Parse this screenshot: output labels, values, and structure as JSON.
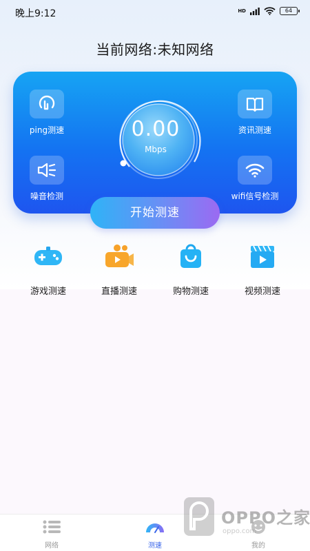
{
  "status_bar": {
    "time": "晚上9:12",
    "network_badge": "HD",
    "battery": "64"
  },
  "header": {
    "title": "当前网络:未知网络"
  },
  "speed_card": {
    "features": [
      {
        "label": "ping测速",
        "icon": "ping-icon"
      },
      {
        "label": "噪音检测",
        "icon": "noise-icon"
      },
      {
        "label": "资讯测速",
        "icon": "book-icon"
      },
      {
        "label": "wifi信号检测",
        "icon": "wifi-icon"
      }
    ],
    "gauge": {
      "value": "0.00",
      "unit": "Mbps",
      "progress": 0
    },
    "start_label": "开始测速"
  },
  "scenarios": [
    {
      "label": "游戏测速",
      "icon": "gamepad-icon"
    },
    {
      "label": "直播测速",
      "icon": "live-camera-icon"
    },
    {
      "label": "购物测速",
      "icon": "shopping-bag-icon"
    },
    {
      "label": "视频测速",
      "icon": "video-icon"
    }
  ],
  "bottom_nav": {
    "items": [
      {
        "label": "网络",
        "icon": "list-icon",
        "active": false
      },
      {
        "label": "测速",
        "icon": "speedometer-icon",
        "active": true
      },
      {
        "label": "我的",
        "icon": "profile-icon",
        "active": false
      }
    ]
  },
  "watermark": {
    "brand": "OPPO之家",
    "site": "oppo.com"
  },
  "colors": {
    "card_top": "#16a4f3",
    "card_bottom": "#1e55ef",
    "button_start": "#2fb3f7",
    "button_end": "#9b6af2",
    "active_nav": "#3a66ea"
  }
}
